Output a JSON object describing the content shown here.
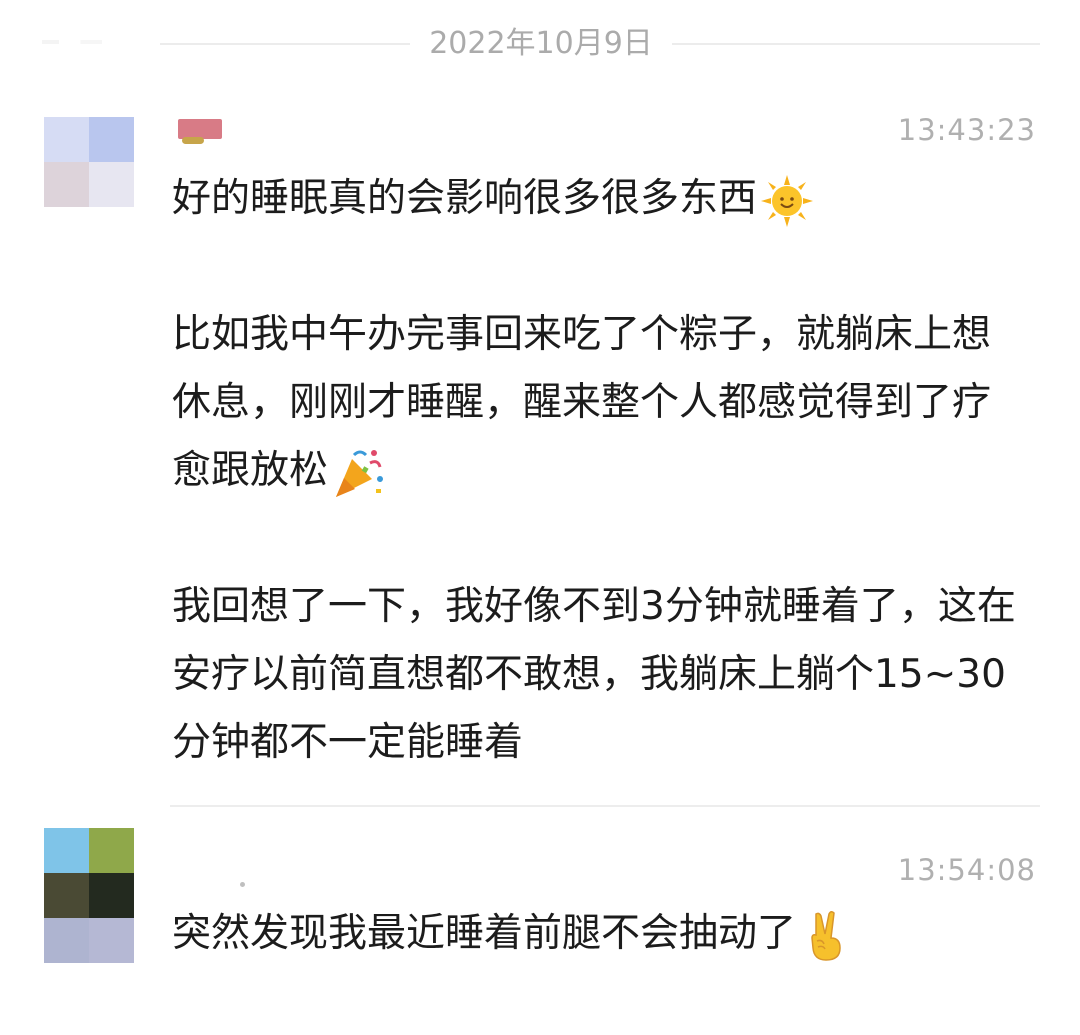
{
  "date_divider": {
    "text": "2022年10月9日"
  },
  "messages": [
    {
      "time": "13:43:23",
      "avatar_colors": [
        "#d6dcf4",
        "#b9c6ee",
        "#ddd3da",
        "#e7e6f1"
      ],
      "paragraphs": [
        {
          "text": "好的睡眠真的会影响很多很多东西",
          "emoji": "sun-icon"
        },
        {
          "text": "比如我中午办完事回来吃了个粽子，就躺床上想休息，刚刚才睡醒，醒来整个人都感觉得到了疗愈跟放松",
          "emoji": "party-popper-icon"
        },
        {
          "text": "我回想了一下，我好像不到3分钟就睡着了，这在安疗以前简直想都不敢想，我躺床上躺个15~30分钟都不一定能睡着"
        }
      ]
    },
    {
      "time": "13:54:08",
      "avatar_colors": [
        "#7fc4e8",
        "#8fa84a",
        "#4a4a34",
        "#232a1f",
        "#aeb4d0",
        "#b5b8d4"
      ],
      "paragraphs": [
        {
          "text": "突然发现我最近睡着前腿不会抽动了",
          "emoji": "victory-hand-icon"
        }
      ]
    }
  ],
  "colors": {
    "text": "#1c1c1c",
    "timestamp": "#b0b0b0",
    "divider": "#ececec"
  }
}
